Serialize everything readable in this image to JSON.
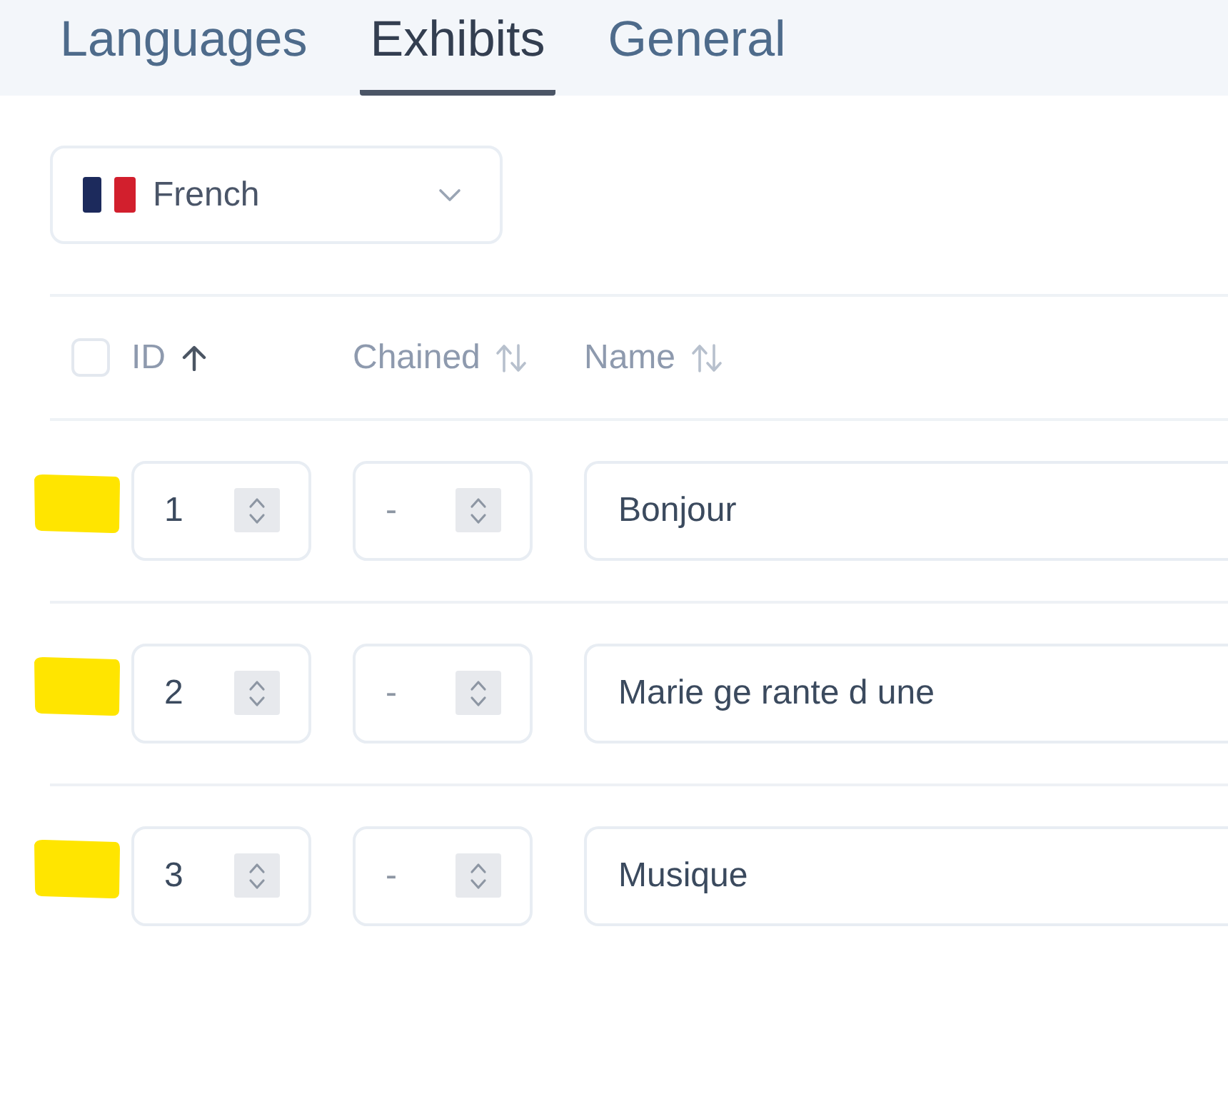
{
  "tabs": [
    {
      "label": "Languages",
      "selected": false
    },
    {
      "label": "Exhibits",
      "selected": true
    },
    {
      "label": "General",
      "selected": false
    }
  ],
  "language_select": {
    "value": "French"
  },
  "table": {
    "select_all": {
      "checked": false
    },
    "columns": [
      {
        "label": "ID",
        "sorted": true
      },
      {
        "label": "Chained",
        "sorted": false
      },
      {
        "label": "Name",
        "sorted": false
      }
    ],
    "rows": [
      {
        "highlighted": true,
        "id": "1",
        "chained": {
          "placeholder": "-"
        },
        "name": "Bonjour"
      },
      {
        "highlighted": true,
        "id": "2",
        "chained": {
          "placeholder": "-"
        },
        "name": "Marie ge rante d une"
      },
      {
        "highlighted": true,
        "id": "3",
        "chained": {
          "placeholder": "-"
        },
        "name": "Musique"
      }
    ]
  }
}
